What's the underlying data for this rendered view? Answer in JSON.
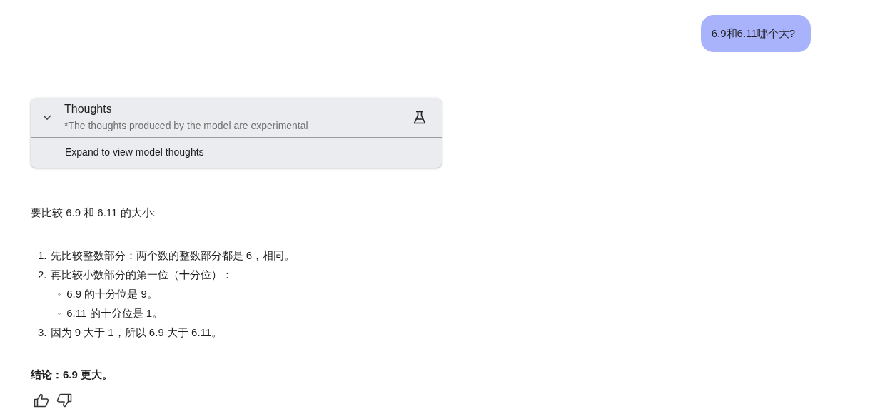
{
  "user_message": "6.9和6.11哪个大?",
  "thoughts": {
    "title": "Thoughts",
    "subtitle": "*The thoughts produced by the model are experimental",
    "expanded": false,
    "expand_label": "Expand to view model thoughts"
  },
  "answer": {
    "intro": "要比较 6.9 和 6.11 的大小:",
    "steps": [
      {
        "marker": "1.",
        "text": "先比较整数部分：两个数的整数部分都是 6，相同。"
      },
      {
        "marker": "2.",
        "text": "再比较小数部分的第一位（十分位）：",
        "children": [
          {
            "marker": "◦",
            "text": "6.9 的十分位是 9。"
          },
          {
            "marker": "◦",
            "text": "6.11 的十分位是 1。"
          }
        ]
      },
      {
        "marker": "3.",
        "text": "因为 9 大于 1，所以 6.9 大于 6.11。"
      }
    ],
    "conclusion": "结论：6.9 更大。"
  }
}
